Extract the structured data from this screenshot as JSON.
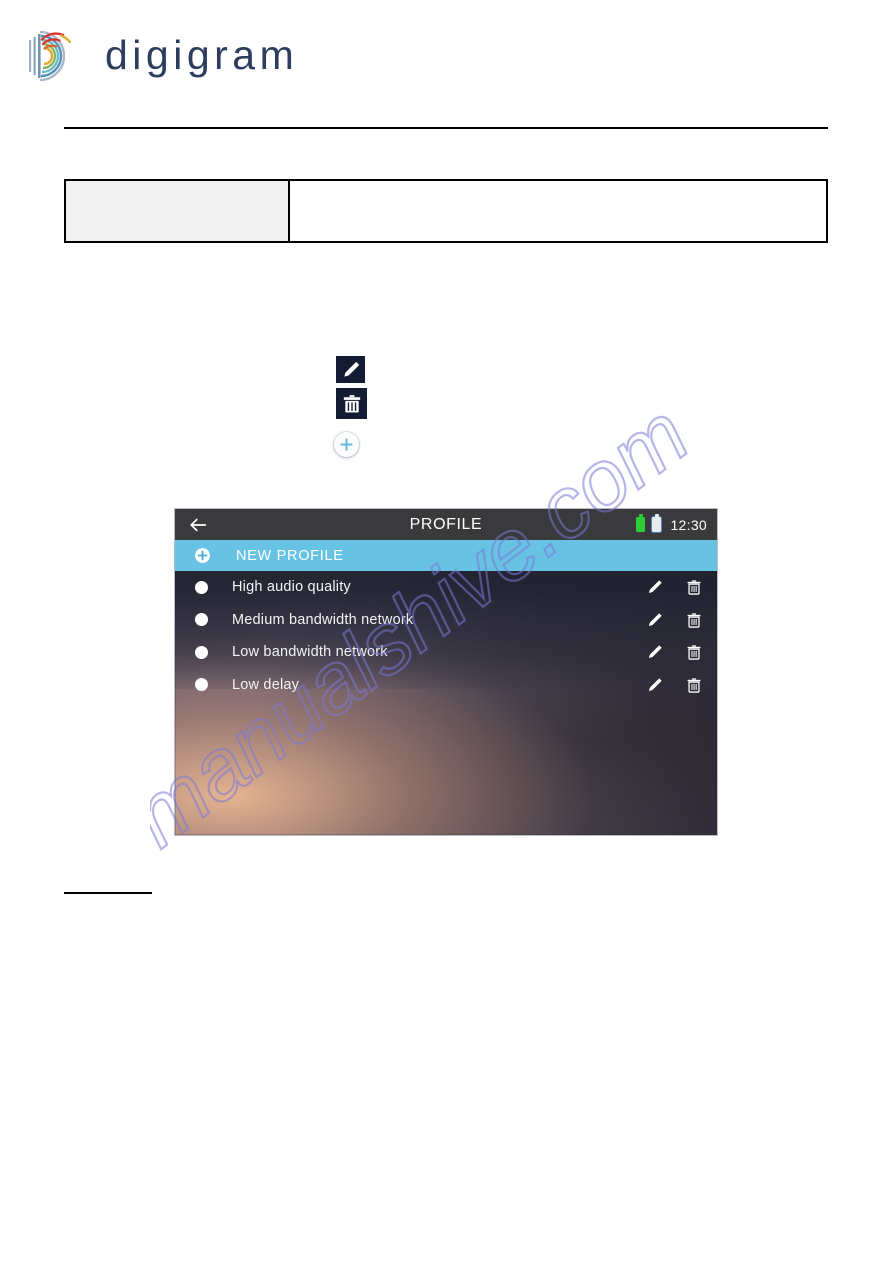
{
  "brand": {
    "wordmark": "digigram",
    "logo_icon": "digigram-arcs-logo",
    "wordmark_color": "#2d3d5e",
    "arc_colors": [
      "#d42a2f",
      "#e8a825",
      "#7db04a",
      "#3a8fc4",
      "#5fb9c9",
      "#8fa3bc"
    ]
  },
  "doc_table": {
    "label_cell_text": "",
    "value_cell_text": "",
    "label_cell_bg": "#f0f0f0"
  },
  "doc_icons": [
    {
      "name": "edit-icon",
      "glyph": "pencil",
      "fg": "#ffffff",
      "bg": "#141c33"
    },
    {
      "name": "delete-icon",
      "glyph": "trash-can",
      "fg": "#ffffff",
      "bg": "#141c33"
    },
    {
      "name": "add-icon",
      "glyph": "plus-circle",
      "fg": "#67c2e4",
      "bg": "#fdfdfd"
    }
  ],
  "device": {
    "status_bar": {
      "back_icon": "arrow-left-icon",
      "title": "PROFILE",
      "battery_primary_icon": "battery-full-icon",
      "battery_primary_color": "#2ecc36",
      "battery_secondary_icon": "battery-icon",
      "battery_secondary_color": "#e8eaec",
      "clock": "12:30",
      "bg": "#3a3a3c"
    },
    "new_profile": {
      "icon": "plus-circle-icon",
      "label": "NEW PROFILE",
      "bg": "#67c2e4"
    },
    "profiles": [
      {
        "name": "High audio quality",
        "selected": false,
        "edit_icon": "pencil-icon",
        "delete_icon": "trash-icon"
      },
      {
        "name": "Medium bandwidth network",
        "selected": false,
        "edit_icon": "pencil-icon",
        "delete_icon": "trash-icon"
      },
      {
        "name": "Low bandwidth network",
        "selected": false,
        "edit_icon": "pencil-icon",
        "delete_icon": "trash-icon"
      },
      {
        "name": "Low delay",
        "selected": false,
        "edit_icon": "pencil-icon",
        "delete_icon": "trash-icon"
      }
    ]
  },
  "watermark": {
    "text": "manualshive.com",
    "color": "#7b79d6"
  }
}
